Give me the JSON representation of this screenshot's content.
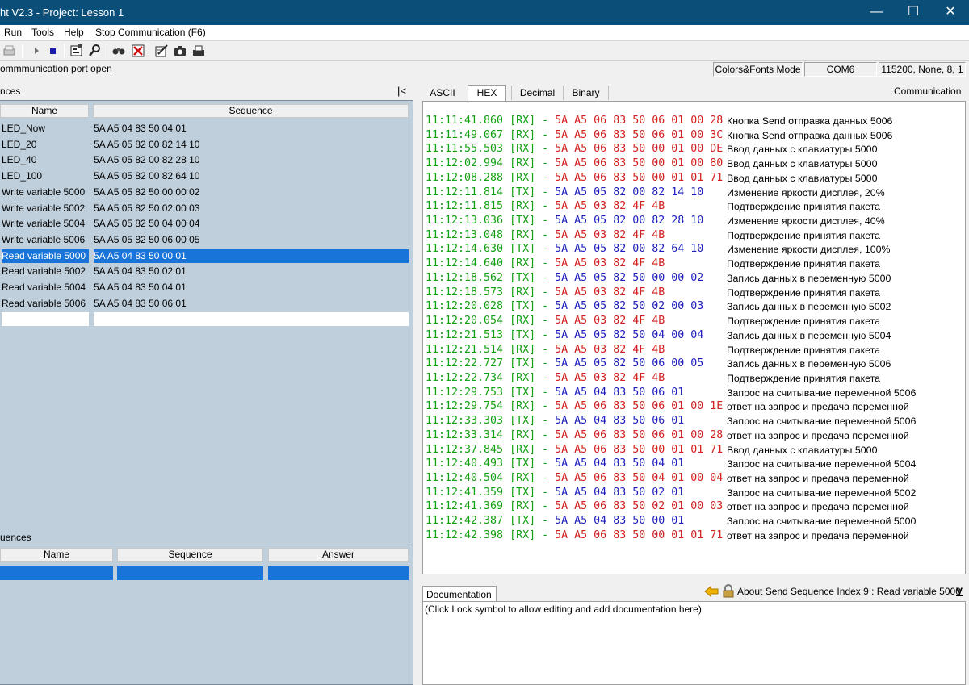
{
  "window": {
    "title": "ht V2.3 - Project: Lesson 1",
    "minimize_glyph": "—",
    "maximize_glyph": "☐",
    "close_glyph": "✕"
  },
  "menu": {
    "run": "Run",
    "tools": "Tools",
    "help": "Help",
    "stop_comm": "Stop Communication  (F6)"
  },
  "toolbar_icons": [
    "print-icon",
    "play-icon",
    "stop-icon",
    "properties-icon",
    "settings-icon",
    "find-icon",
    "clear-icon",
    "edit-icon",
    "capture-icon",
    "record-icon"
  ],
  "status": {
    "message": "ommmunication port open",
    "mode": "Colors&Fonts Mode",
    "port": "COM6",
    "settings": "115200, None, 8, 1"
  },
  "left": {
    "send_title": "nces",
    "collapse_label": "|<",
    "send_headers": {
      "name": "Name",
      "sequence": "Sequence"
    },
    "send_rows": [
      {
        "name": "LED_Now",
        "sequence": "5A A5 04 83 50 04 01"
      },
      {
        "name": "LED_20",
        "sequence": "5A A5 05 82 00 82 14 10"
      },
      {
        "name": "LED_40",
        "sequence": "5A A5 05 82 00 82 28 10"
      },
      {
        "name": "LED_100",
        "sequence": "5A A5 05 82 00 82 64 10"
      },
      {
        "name": "Write variable 5000",
        "sequence": "5A A5 05 82 50 00 00 02"
      },
      {
        "name": "Write variable 5002",
        "sequence": "5A A5 05 82 50 02 00 03"
      },
      {
        "name": "Write variable 5004",
        "sequence": "5A A5 05 82 50 04 00 04"
      },
      {
        "name": "Write variable 5006",
        "sequence": "5A A5 05 82 50 06 00 05"
      },
      {
        "name": "Read variable 5000",
        "sequence": "5A A5 04 83 50 00 01"
      },
      {
        "name": "Read variable 5002",
        "sequence": "5A A5 04 83 50 02 01"
      },
      {
        "name": "Read variable 5004",
        "sequence": "5A A5 04 83 50 04 01"
      },
      {
        "name": "Read variable 5006",
        "sequence": "5A A5 04 83 50 06 01"
      }
    ],
    "receive_title": "uences",
    "receive_headers": {
      "name": "Name",
      "sequence": "Sequence",
      "answer": "Answer"
    }
  },
  "right": {
    "tabs": [
      "ASCII",
      "HEX",
      "Decimal",
      "Binary"
    ],
    "active_tab": "HEX",
    "communication_label": "Communication",
    "log": [
      {
        "time": "11:11:41.860",
        "dir": "RX",
        "data": "5A A5 06 83 50 06 01 00 28",
        "desc": "Кнопка Send отправка данных 5006"
      },
      {
        "time": "11:11:49.067",
        "dir": "RX",
        "data": "5A A5 06 83 50 06 01 00 3C",
        "desc": "Кнопка Send отправка данных 5006"
      },
      {
        "time": "11:11:55.503",
        "dir": "RX",
        "data": "5A A5 06 83 50 00 01 00 DE",
        "desc": "Ввод данных с клавиатуры 5000"
      },
      {
        "time": "11:12:02.994",
        "dir": "RX",
        "data": "5A A5 06 83 50 00 01 00 80",
        "desc": "Ввод данных с клавиатуры 5000"
      },
      {
        "time": "11:12:08.288",
        "dir": "RX",
        "data": "5A A5 06 83 50 00 01 01 71",
        "desc": "Ввод данных с клавиатуры 5000"
      },
      {
        "time": "11:12:11.814",
        "dir": "TX",
        "data": "5A A5 05 82 00 82 14 10",
        "desc": "Изменение яркости дисплея, 20%"
      },
      {
        "time": "11:12:11.815",
        "dir": "RX",
        "data": "5A A5 03 82 4F 4B",
        "desc": "Подтверждение принятия пакета"
      },
      {
        "time": "11:12:13.036",
        "dir": "TX",
        "data": "5A A5 05 82 00 82 28 10",
        "desc": "Изменение яркости дисплея, 40%"
      },
      {
        "time": "11:12:13.048",
        "dir": "RX",
        "data": "5A A5 03 82 4F 4B",
        "desc": "Подтверждение принятия пакета"
      },
      {
        "time": "11:12:14.630",
        "dir": "TX",
        "data": "5A A5 05 82 00 82 64 10",
        "desc": "Изменение яркости дисплея, 100%"
      },
      {
        "time": "11:12:14.640",
        "dir": "RX",
        "data": "5A A5 03 82 4F 4B",
        "desc": "Подтверждение принятия пакета"
      },
      {
        "time": "11:12:18.562",
        "dir": "TX",
        "data": "5A A5 05 82 50 00 00 02",
        "desc": "Запись данных в переменную 5000"
      },
      {
        "time": "11:12:18.573",
        "dir": "RX",
        "data": "5A A5 03 82 4F 4B",
        "desc": "Подтверждение принятия пакета"
      },
      {
        "time": "11:12:20.028",
        "dir": "TX",
        "data": "5A A5 05 82 50 02 00 03",
        "desc": "Запись данных в переменную 5002"
      },
      {
        "time": "11:12:20.054",
        "dir": "RX",
        "data": "5A A5 03 82 4F 4B",
        "desc": "Подтверждение принятия пакета"
      },
      {
        "time": "11:12:21.513",
        "dir": "TX",
        "data": "5A A5 05 82 50 04 00 04",
        "desc": "Запись данных в переменную 5004"
      },
      {
        "time": "11:12:21.514",
        "dir": "RX",
        "data": "5A A5 03 82 4F 4B",
        "desc": "Подтверждение принятия пакета"
      },
      {
        "time": "11:12:22.727",
        "dir": "TX",
        "data": "5A A5 05 82 50 06 00 05",
        "desc": "Запись данных в переменную 5006"
      },
      {
        "time": "11:12:22.734",
        "dir": "RX",
        "data": "5A A5 03 82 4F 4B",
        "desc": "Подтверждение принятия пакета"
      },
      {
        "time": "11:12:29.753",
        "dir": "TX",
        "data": "5A A5 04 83 50 06 01",
        "desc": "Запрос на считывание переменной 5006"
      },
      {
        "time": "11:12:29.754",
        "dir": "RX",
        "data": "5A A5 06 83 50 06 01 00 1E",
        "desc": "ответ на запрос и предача переменной"
      },
      {
        "time": "11:12:33.303",
        "dir": "TX",
        "data": "5A A5 04 83 50 06 01",
        "desc": "Запрос на считывание переменной 5006"
      },
      {
        "time": "11:12:33.314",
        "dir": "RX",
        "data": "5A A5 06 83 50 06 01 00 28",
        "desc": "ответ на запрос и предача переменной"
      },
      {
        "time": "11:12:37.845",
        "dir": "RX",
        "data": "5A A5 06 83 50 00 01 01 71",
        "desc": "Ввод данных с клавиатуры 5000"
      },
      {
        "time": "11:12:40.493",
        "dir": "TX",
        "data": "5A A5 04 83 50 04 01",
        "desc": "Запрос на считывание переменной 5004"
      },
      {
        "time": "11:12:40.504",
        "dir": "RX",
        "data": "5A A5 06 83 50 04 01 00 04",
        "desc": "ответ на запрос и предача переменной"
      },
      {
        "time": "11:12:41.359",
        "dir": "TX",
        "data": "5A A5 04 83 50 02 01",
        "desc": "Запрос на считывание переменной 5002"
      },
      {
        "time": "11:12:41.369",
        "dir": "RX",
        "data": "5A A5 06 83 50 02 01 00 03",
        "desc": "ответ на запрос и предача переменной"
      },
      {
        "time": "11:12:42.387",
        "dir": "TX",
        "data": "5A A5 04 83 50 00 01",
        "desc": "Запрос на считывание переменной 5000"
      },
      {
        "time": "11:12:42.398",
        "dir": "RX",
        "data": "5A A5 06 83 50 00 01 01 71",
        "desc": "ответ на запрос и предача переменной"
      }
    ],
    "doc_tab": "Documentation",
    "doc_about": "About Send Sequence Index 9 : Read variable 5000",
    "doc_v": "V",
    "doc_text": "(Click Lock symbol to allow editing and add documentation here)"
  },
  "colors": {
    "titlebar": "#0b4e77",
    "selection": "#1874d8",
    "timestamp": "#12a012",
    "rx": "#d22020",
    "tx": "#1d1dbb",
    "grid_bg": "#bfcfdc"
  }
}
